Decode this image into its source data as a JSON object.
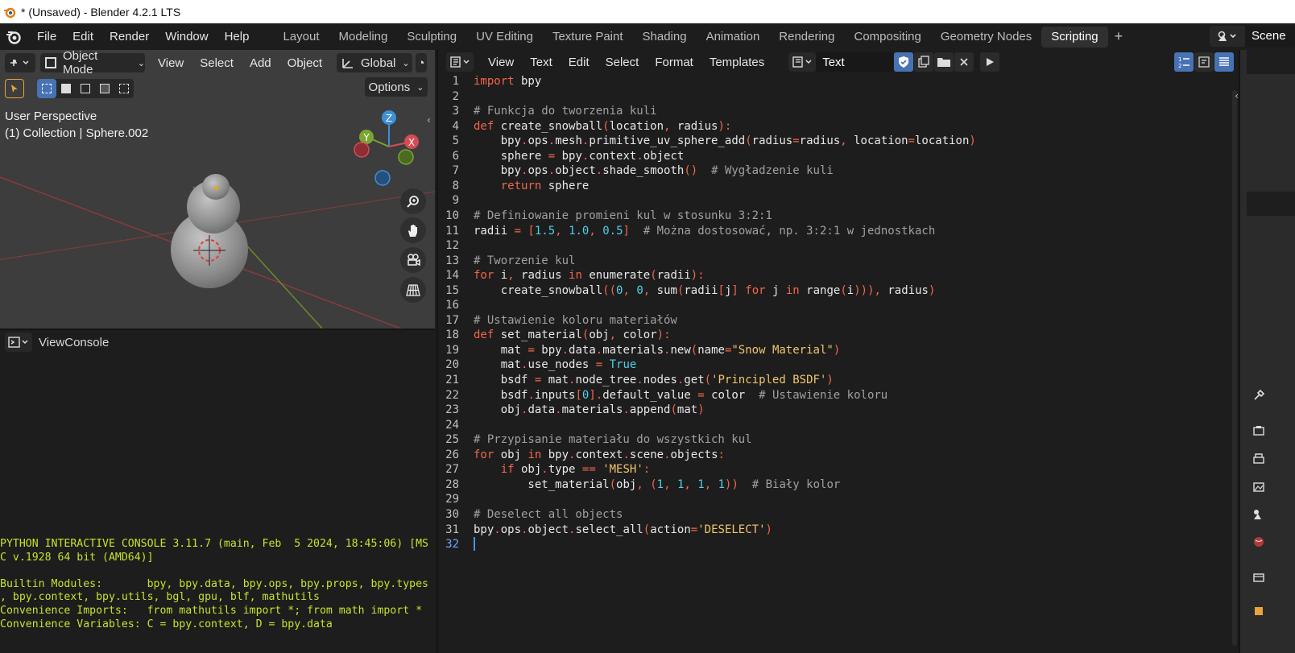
{
  "window": {
    "title": "* (Unsaved) - Blender 4.2.1 LTS"
  },
  "menu": [
    "File",
    "Edit",
    "Render",
    "Window",
    "Help"
  ],
  "workspaces": {
    "tabs": [
      "Layout",
      "Modeling",
      "Sculpting",
      "UV Editing",
      "Texture Paint",
      "Shading",
      "Animation",
      "Rendering",
      "Compositing",
      "Geometry Nodes",
      "Scripting"
    ],
    "active": "Scripting"
  },
  "scene": {
    "name": "Scene"
  },
  "viewport": {
    "mode": "Object Mode",
    "menus": [
      "View",
      "Select",
      "Add",
      "Object"
    ],
    "orientation": "Global",
    "options_label": "Options",
    "perspective": "User Perspective",
    "collection": "(1) Collection | Sphere.002",
    "axes": {
      "x": "X",
      "y": "Y",
      "z": "Z"
    }
  },
  "console": {
    "menus": [
      "View",
      "Console"
    ],
    "lines": [
      "PYTHON INTERACTIVE CONSOLE 3.11.7 (main, Feb  5 2024, 18:45:06) [MS",
      "C v.1928 64 bit (AMD64)]",
      "",
      "Builtin Modules:       bpy, bpy.data, bpy.ops, bpy.props, bpy.types",
      ", bpy.context, bpy.utils, bgl, gpu, blf, mathutils",
      "Convenience Imports:   from mathutils import *; from math import *",
      "Convenience Variables: C = bpy.context, D = bpy.data"
    ]
  },
  "text_editor": {
    "menus": [
      "View",
      "Text",
      "Edit",
      "Select",
      "Format",
      "Templates"
    ],
    "text_name": "Text",
    "code_lines": [
      "import bpy",
      "",
      "# Funkcja do tworzenia kuli",
      "def create_snowball(location, radius):",
      "    bpy.ops.mesh.primitive_uv_sphere_add(radius=radius, location=location)",
      "    sphere = bpy.context.object",
      "    bpy.ops.object.shade_smooth()  # Wygładzenie kuli",
      "    return sphere",
      "",
      "# Definiowanie promieni kul w stosunku 3:2:1",
      "radii = [1.5, 1.0, 0.5]  # Można dostosować, np. 3:2:1 w jednostkach",
      "",
      "# Tworzenie kul",
      "for i, radius in enumerate(radii):",
      "    create_snowball((0, 0, sum(radii[j] for j in range(i))), radius)",
      "",
      "# Ustawienie koloru materiałów",
      "def set_material(obj, color):",
      "    mat = bpy.data.materials.new(name=\"Snow Material\")",
      "    mat.use_nodes = True",
      "    bsdf = mat.node_tree.nodes.get('Principled BSDF')",
      "    bsdf.inputs[0].default_value = color  # Ustawienie koloru",
      "    obj.data.materials.append(mat)",
      "",
      "# Przypisanie materiału do wszystkich kul",
      "for obj in bpy.context.scene.objects:",
      "    if obj.type == 'MESH':",
      "        set_material(obj, (1, 1, 1, 1))  # Biały kolor",
      "",
      "# Deselect all objects",
      "bpy.ops.object.select_all(action='DESELECT')",
      ""
    ],
    "current_line": 32
  },
  "colors": {
    "accent": "#4772b3",
    "keyword": "#f0674a",
    "string": "#f2c46d",
    "number": "#4fd0e8",
    "comment": "#a0a0a0",
    "console_text": "#c5e32a"
  }
}
